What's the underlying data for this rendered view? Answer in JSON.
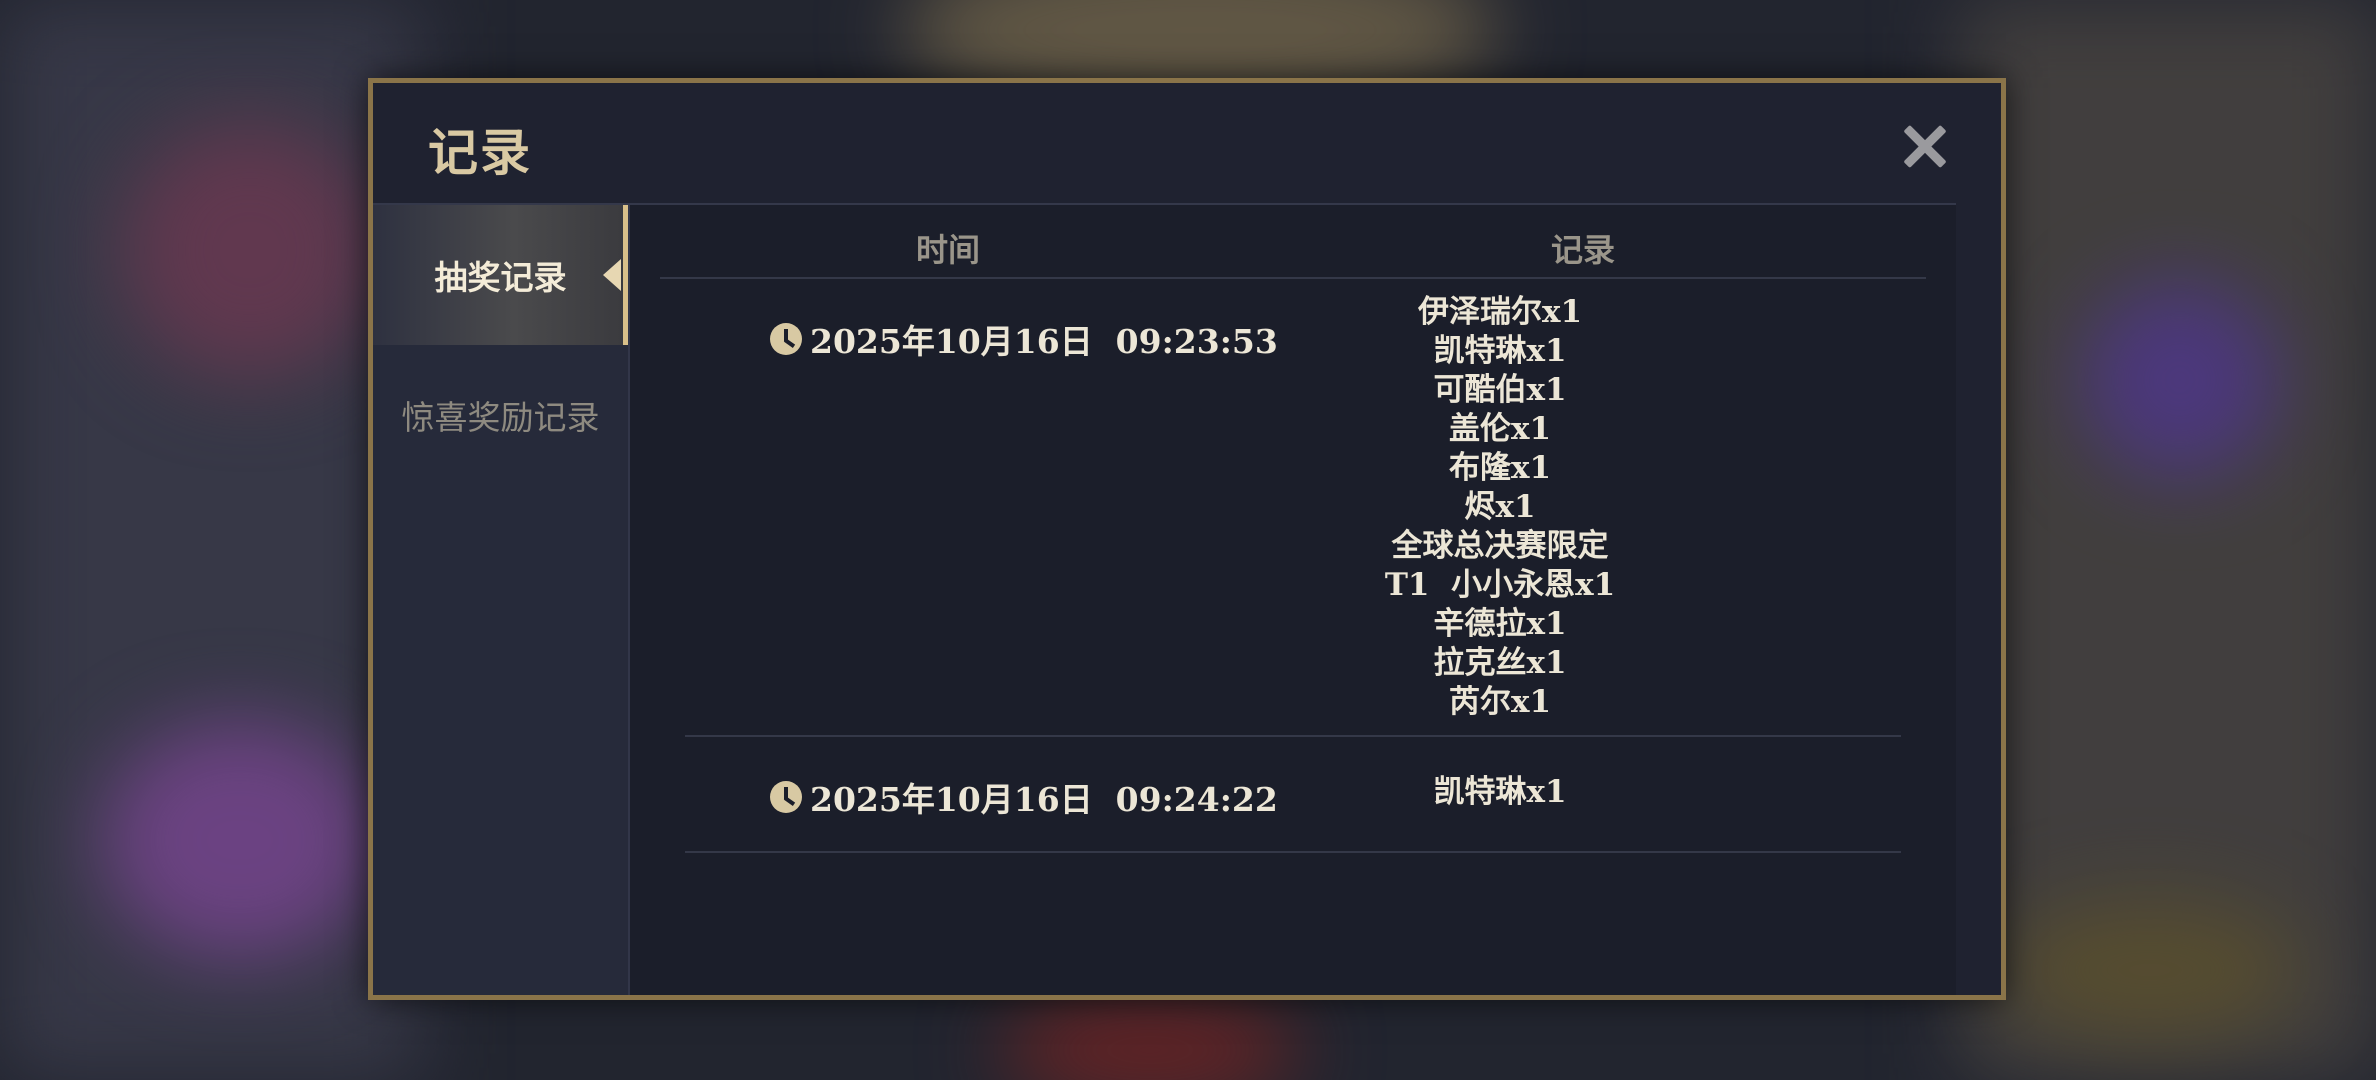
{
  "modal": {
    "title": "记录"
  },
  "sidebar": {
    "tabs": [
      {
        "label": "抽奖记录",
        "active": true
      },
      {
        "label": "惊喜奖励记录",
        "active": false
      }
    ]
  },
  "table": {
    "headers": {
      "time": "时间",
      "record": "记录"
    },
    "rows": [
      {
        "time": "2025年10月16日  09:23:53",
        "items": [
          "伊泽瑞尔x1",
          "凯特琳x1",
          "可酷伯x1",
          "盖伦x1",
          "布隆x1",
          "烬x1",
          "全球总决赛限定",
          "T1  小小永恩x1",
          "辛德拉x1",
          "拉克丝x1",
          "芮尔x1"
        ]
      },
      {
        "time": "2025年10月16日  09:24:22",
        "items": [
          "凯特琳x1"
        ]
      }
    ]
  },
  "colors": {
    "accent_gold": "#8a7449",
    "title_text": "#d9c9a3",
    "panel_bg": "#1e2130"
  },
  "icons": {
    "close": "close-icon",
    "clock": "clock-icon",
    "tab_pointer": "chevron-left-icon"
  }
}
